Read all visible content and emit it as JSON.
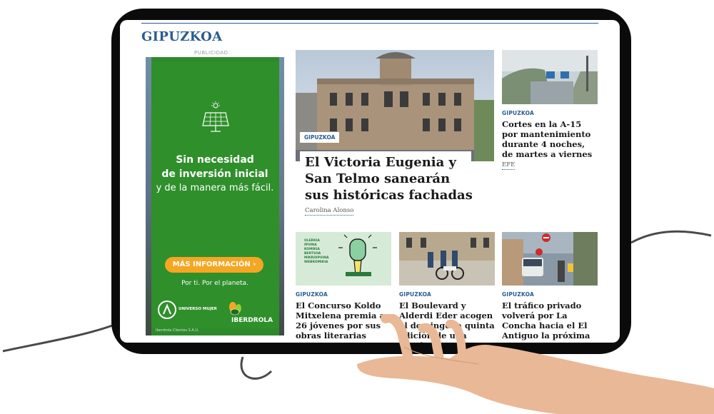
{
  "section": {
    "title": "GIPUZKOA"
  },
  "ad": {
    "label": "PUBLICIDAD",
    "line1": "Sin necesidad",
    "line2": "de inversión inicial",
    "line3": "y de la manera más fácil.",
    "cta": "MÁS INFORMACIÓN",
    "tagline": "Por ti. Por el planeta.",
    "brand1": "UNIVERSO MUJER",
    "brand2": "IBERDROLA",
    "footer": "Iberdrola Clientes S.A.U."
  },
  "hero": {
    "kicker": "GIPUZKOA",
    "title": "El Victoria Eugenia y San Telmo sanearán sus históricas fachadas",
    "author": "Carolina Alonso"
  },
  "side": {
    "kicker": "GIPUZKOA",
    "title": "Cortes en la A-15 por mantenimiento durante 4 noches, de martes a viernes",
    "author": "EFE"
  },
  "cards": [
    {
      "kicker": "GIPUZKOA",
      "title": "El Concurso Koldo Mitxelena premia a 26 jóvenes por sus obras literarias"
    },
    {
      "kicker": "GIPUZKOA",
      "title": "El Boulevard y Alderdi Eder acogen el domingo la quinta edición de una prueba"
    },
    {
      "kicker": "GIPUZKOA",
      "title": "El tráfico privado volverá por La Concha hacia el El Antiguo la próxima semana"
    }
  ],
  "poster": {
    "text": "OLERKIA IPUINA KOMIKIA BERTSOA MIKROIPUINA WEBKOMIKIA"
  },
  "colors": {
    "accent": "#2a5d8f",
    "ad_green": "#2f8f2b",
    "cta_orange": "#f5a623"
  }
}
